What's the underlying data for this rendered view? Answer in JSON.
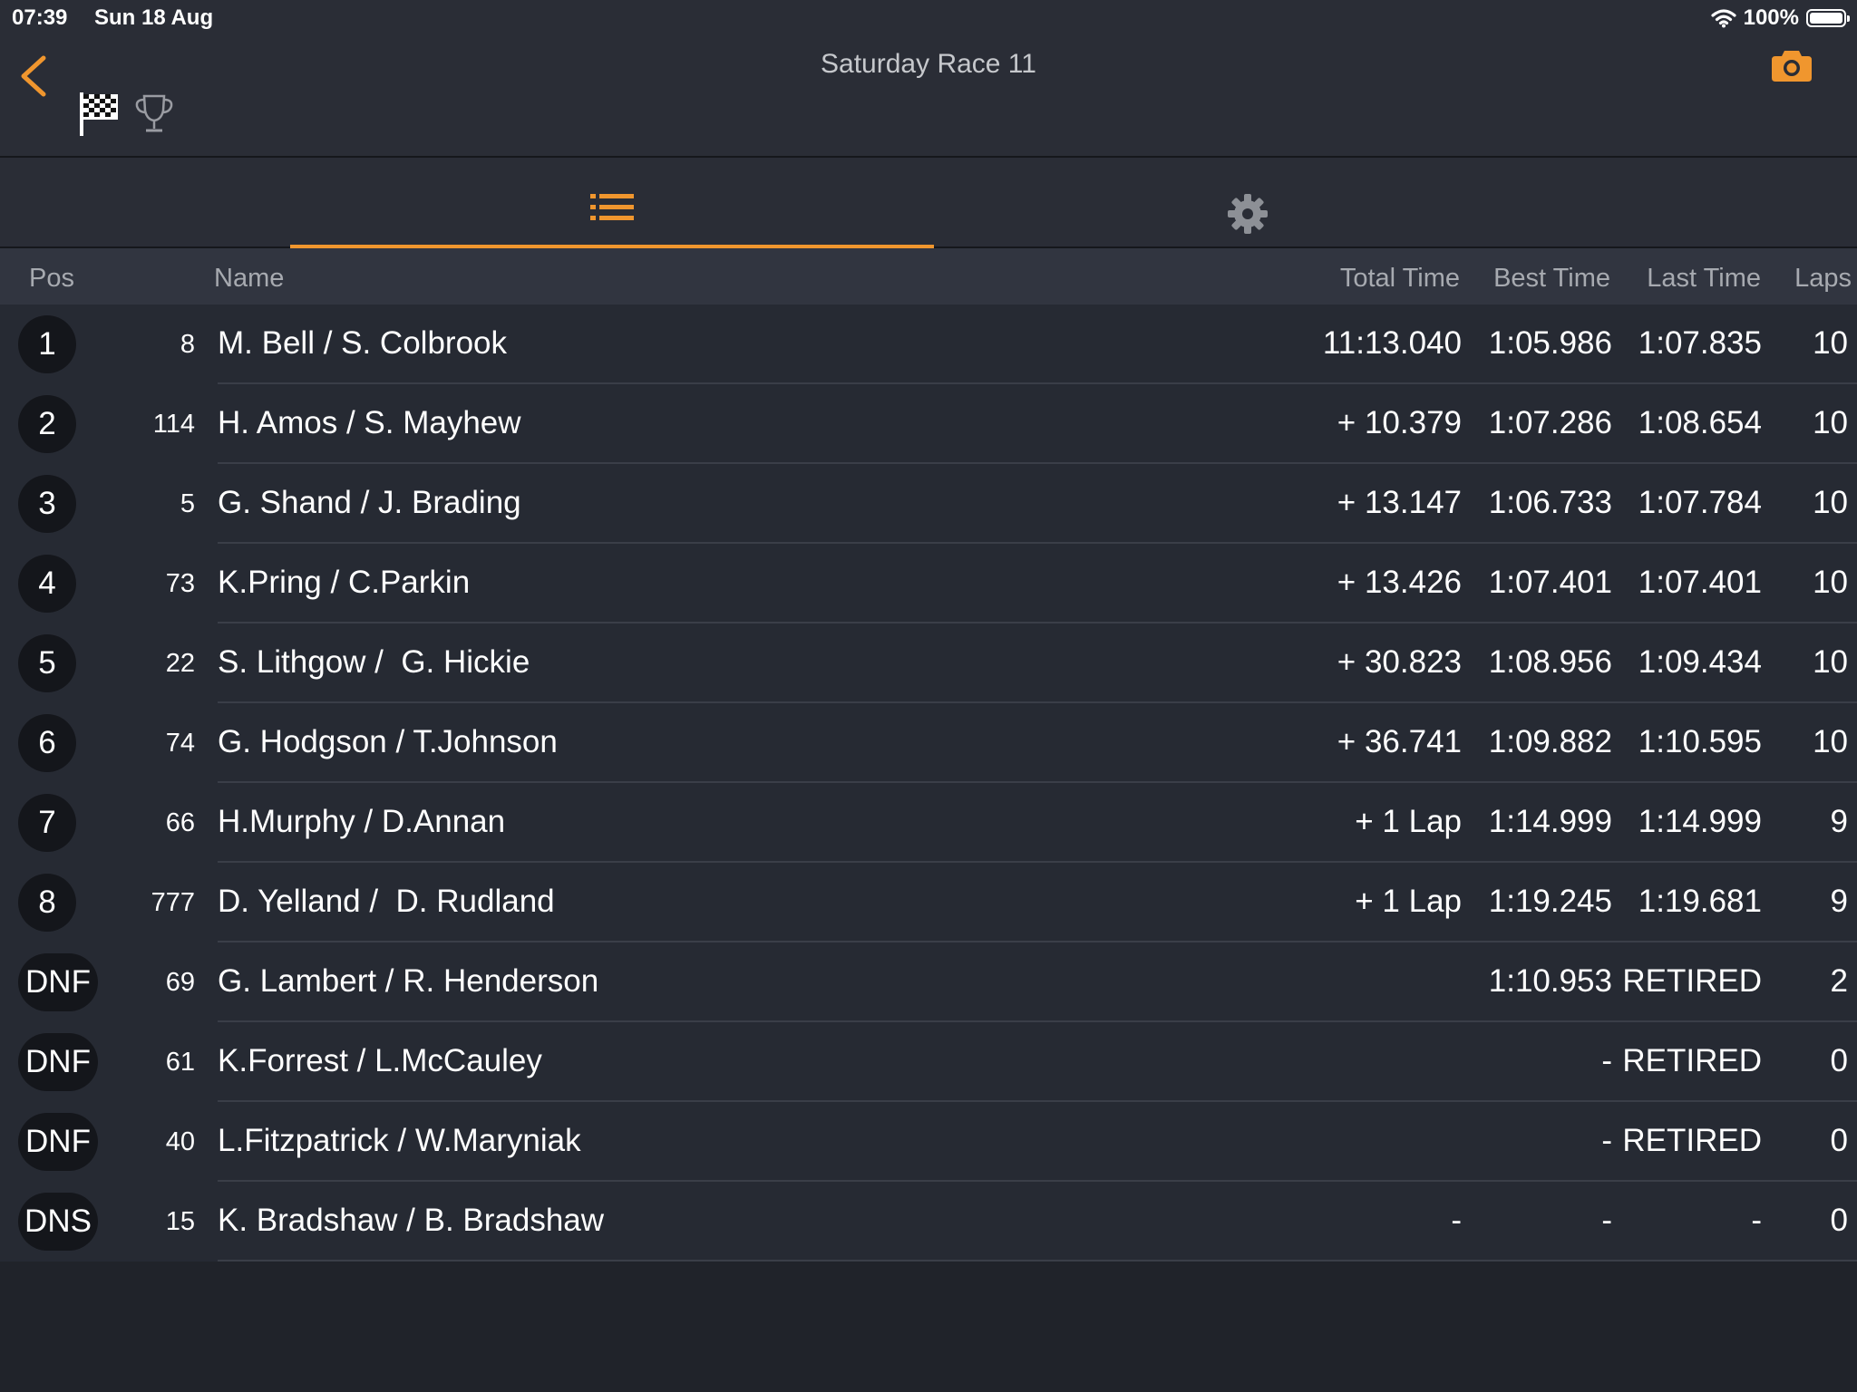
{
  "status_bar": {
    "time": "07:39",
    "date": "Sun 18 Aug",
    "battery": "100%",
    "icons": [
      "wifi-icon",
      "battery-icon"
    ]
  },
  "header": {
    "title": "Saturday Race 11",
    "icons": [
      "chevron-left-icon",
      "checkered-flag-icon",
      "trophy-icon",
      "camera-icon"
    ],
    "accent_color": "#f0962e"
  },
  "tabs": [
    {
      "icon": "list-icon",
      "active": true
    },
    {
      "icon": "gear-icon",
      "active": false
    }
  ],
  "table": {
    "columns": {
      "pos": "Pos",
      "name": "Name",
      "total": "Total Time",
      "best": "Best Time",
      "last": "Last Time",
      "laps": "Laps"
    },
    "rows": [
      {
        "pos": "1",
        "number": "8",
        "name": "M. Bell / S. Colbrook",
        "total": "11:13.040",
        "best": "1:05.986",
        "last": "1:07.835",
        "laps": "10"
      },
      {
        "pos": "2",
        "number": "114",
        "name": "H. Amos / S. Mayhew",
        "total": "+ 10.379",
        "best": "1:07.286",
        "last": "1:08.654",
        "laps": "10"
      },
      {
        "pos": "3",
        "number": "5",
        "name": "G. Shand / J. Brading",
        "total": "+ 13.147",
        "best": "1:06.733",
        "last": "1:07.784",
        "laps": "10"
      },
      {
        "pos": "4",
        "number": "73",
        "name": "K.Pring / C.Parkin",
        "total": "+ 13.426",
        "best": "1:07.401",
        "last": "1:07.401",
        "laps": "10"
      },
      {
        "pos": "5",
        "number": "22",
        "name": "S. Lithgow /  G. Hickie",
        "total": "+ 30.823",
        "best": "1:08.956",
        "last": "1:09.434",
        "laps": "10"
      },
      {
        "pos": "6",
        "number": "74",
        "name": "G. Hodgson / T.Johnson",
        "total": "+ 36.741",
        "best": "1:09.882",
        "last": "1:10.595",
        "laps": "10"
      },
      {
        "pos": "7",
        "number": "66",
        "name": "H.Murphy / D.Annan",
        "total": "+ 1 Lap",
        "best": "1:14.999",
        "last": "1:14.999",
        "laps": "9"
      },
      {
        "pos": "8",
        "number": "777",
        "name": "D. Yelland /  D. Rudland",
        "total": "+ 1 Lap",
        "best": "1:19.245",
        "last": "1:19.681",
        "laps": "9"
      },
      {
        "pos": "DNF",
        "number": "69",
        "name": "G. Lambert / R. Henderson",
        "total": "",
        "best": "1:10.953",
        "last": "RETIRED",
        "laps": "2"
      },
      {
        "pos": "DNF",
        "number": "61",
        "name": "K.Forrest / L.McCauley",
        "total": "",
        "best": "-",
        "last": "RETIRED",
        "laps": "0"
      },
      {
        "pos": "DNF",
        "number": "40",
        "name": "L.Fitzpatrick / W.Maryniak",
        "total": "",
        "best": "-",
        "last": "RETIRED",
        "laps": "0"
      },
      {
        "pos": "DNS",
        "number": "15",
        "name": "K. Bradshaw / B. Bradshaw",
        "total": "-",
        "best": "-",
        "last": "-",
        "laps": "0"
      }
    ]
  }
}
